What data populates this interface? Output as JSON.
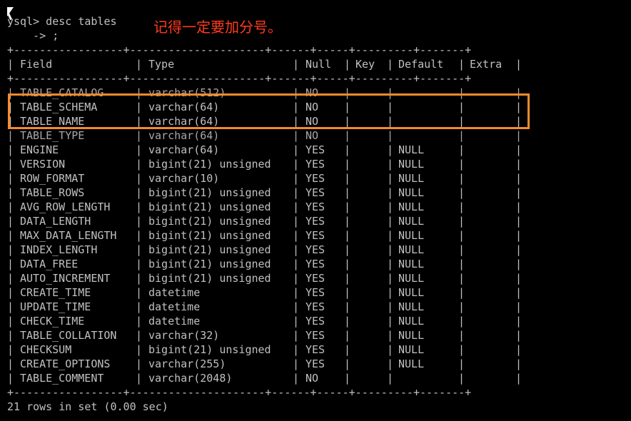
{
  "terminal": {
    "prompt_line": "ysql> desc tables",
    "continuation_line": "    -> ;",
    "annotation_text": "记得一定要加分号。",
    "border_line": "+-----------------+---------------------+------+-----+---------+-------+",
    "headers": {
      "field": "Field",
      "type": "Type",
      "null": "Null",
      "key": "Key",
      "default": "Default",
      "extra": "Extra"
    },
    "rows": [
      {
        "field": "TABLE_CATALOG",
        "type": "varchar(512)",
        "null": "NO",
        "key": "",
        "default": "",
        "extra": ""
      },
      {
        "field": "TABLE_SCHEMA",
        "type": "varchar(64)",
        "null": "NO",
        "key": "",
        "default": "",
        "extra": ""
      },
      {
        "field": "TABLE_NAME",
        "type": "varchar(64)",
        "null": "NO",
        "key": "",
        "default": "",
        "extra": ""
      },
      {
        "field": "TABLE_TYPE",
        "type": "varchar(64)",
        "null": "NO",
        "key": "",
        "default": "",
        "extra": ""
      },
      {
        "field": "ENGINE",
        "type": "varchar(64)",
        "null": "YES",
        "key": "",
        "default": "NULL",
        "extra": ""
      },
      {
        "field": "VERSION",
        "type": "bigint(21) unsigned",
        "null": "YES",
        "key": "",
        "default": "NULL",
        "extra": ""
      },
      {
        "field": "ROW_FORMAT",
        "type": "varchar(10)",
        "null": "YES",
        "key": "",
        "default": "NULL",
        "extra": ""
      },
      {
        "field": "TABLE_ROWS",
        "type": "bigint(21) unsigned",
        "null": "YES",
        "key": "",
        "default": "NULL",
        "extra": ""
      },
      {
        "field": "AVG_ROW_LENGTH",
        "type": "bigint(21) unsigned",
        "null": "YES",
        "key": "",
        "default": "NULL",
        "extra": ""
      },
      {
        "field": "DATA_LENGTH",
        "type": "bigint(21) unsigned",
        "null": "YES",
        "key": "",
        "default": "NULL",
        "extra": ""
      },
      {
        "field": "MAX_DATA_LENGTH",
        "type": "bigint(21) unsigned",
        "null": "YES",
        "key": "",
        "default": "NULL",
        "extra": ""
      },
      {
        "field": "INDEX_LENGTH",
        "type": "bigint(21) unsigned",
        "null": "YES",
        "key": "",
        "default": "NULL",
        "extra": ""
      },
      {
        "field": "DATA_FREE",
        "type": "bigint(21) unsigned",
        "null": "YES",
        "key": "",
        "default": "NULL",
        "extra": ""
      },
      {
        "field": "AUTO_INCREMENT",
        "type": "bigint(21) unsigned",
        "null": "YES",
        "key": "",
        "default": "NULL",
        "extra": ""
      },
      {
        "field": "CREATE_TIME",
        "type": "datetime",
        "null": "YES",
        "key": "",
        "default": "NULL",
        "extra": ""
      },
      {
        "field": "UPDATE_TIME",
        "type": "datetime",
        "null": "YES",
        "key": "",
        "default": "NULL",
        "extra": ""
      },
      {
        "field": "CHECK_TIME",
        "type": "datetime",
        "null": "YES",
        "key": "",
        "default": "NULL",
        "extra": ""
      },
      {
        "field": "TABLE_COLLATION",
        "type": "varchar(32)",
        "null": "YES",
        "key": "",
        "default": "NULL",
        "extra": ""
      },
      {
        "field": "CHECKSUM",
        "type": "bigint(21) unsigned",
        "null": "YES",
        "key": "",
        "default": "NULL",
        "extra": ""
      },
      {
        "field": "CREATE_OPTIONS",
        "type": "varchar(255)",
        "null": "YES",
        "key": "",
        "default": "NULL",
        "extra": ""
      },
      {
        "field": "TABLE_COMMENT",
        "type": "varchar(2048)",
        "null": "NO",
        "key": "",
        "default": "",
        "extra": ""
      }
    ],
    "result_summary": "21 rows in set (0.00 sec)"
  },
  "colors": {
    "background": "#000000",
    "text": "#c0c0c0",
    "annotation": "#ff3b1f",
    "highlight_border": "#f58a2c",
    "cursor": "#ffffff"
  },
  "icons": {
    "cursor": "mouse-pointer-icon"
  }
}
